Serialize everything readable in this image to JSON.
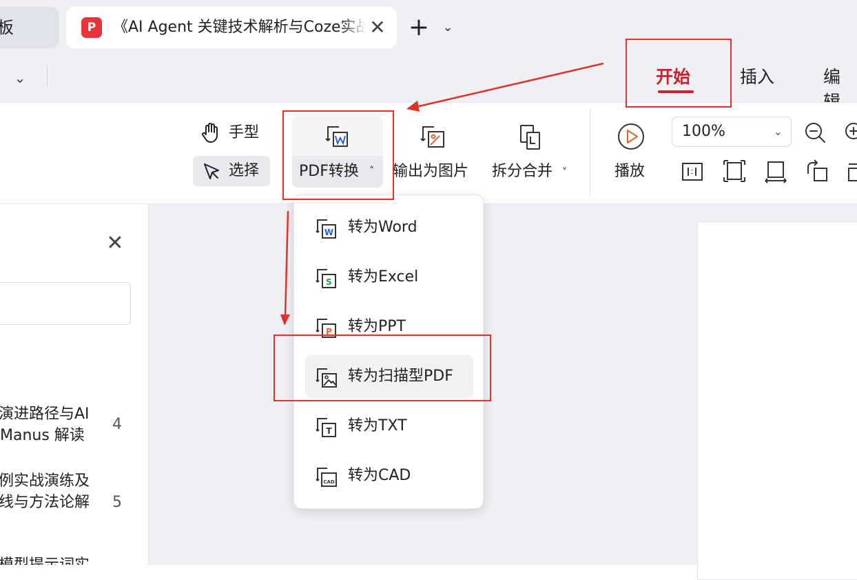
{
  "tabs": {
    "partial_tab_text": "板",
    "active_title": "《AI Agent 关键技术解析与Coze实战》",
    "logo_glyph": "P",
    "close_glyph": "✕",
    "new_tab_glyph": "+",
    "dropdown_glyph": "⌄"
  },
  "menu": {
    "chevron_glyph": "⌄",
    "items": [
      "开始",
      "插入",
      "编辑"
    ],
    "active_color": "#c8232c"
  },
  "toolbar": {
    "hand_label": "手型",
    "select_label": "选择",
    "pdf_convert_label": "PDF转换",
    "pdf_convert_caret": "˄",
    "export_image_label": "输出为图片",
    "split_merge_label": "拆分合并",
    "split_merge_caret": "˅",
    "play_label": "播放",
    "zoom_value": "100%",
    "zoom_chevron": "⌄",
    "icons": [
      "hand-icon",
      "pointer-icon",
      "pdf-to-word-icon",
      "image-export-icon",
      "split-merge-icon",
      "play-icon",
      "zoom-out-icon",
      "zoom-in-icon",
      "actual-size-icon",
      "fit-page-icon",
      "fit-width-icon",
      "rotate-icon"
    ]
  },
  "left_panel": {
    "close_glyph": "✕",
    "toc": [
      {
        "line1": "演进路径与AI",
        "line2": "Manus 解读",
        "page": "4"
      },
      {
        "line1": "例实战演练及",
        "line2": "线与方法论解",
        "page": "5"
      },
      {
        "line1": "模型提示词实",
        "line2": "",
        "page": ""
      }
    ]
  },
  "convert_menu": {
    "items": [
      {
        "label": "转为Word",
        "icon": "word-doc-icon",
        "badge": "W",
        "badge_color": "#2b5fd9"
      },
      {
        "label": "转为Excel",
        "icon": "excel-doc-icon",
        "badge": "S",
        "badge_color": "#1e9e5a"
      },
      {
        "label": "转为PPT",
        "icon": "ppt-doc-icon",
        "badge": "P",
        "badge_color": "#e0632b"
      },
      {
        "label": "转为扫描型PDF",
        "icon": "scan-pdf-icon",
        "badge": "",
        "badge_color": "#333333"
      },
      {
        "label": "转为TXT",
        "icon": "txt-doc-icon",
        "badge": "T",
        "badge_color": "#333333"
      },
      {
        "label": "转为CAD",
        "icon": "cad-doc-icon",
        "badge": "CAD",
        "badge_color": "#333333"
      }
    ],
    "highlighted_index": 3
  },
  "annotation": {
    "color": "#e2302a"
  }
}
